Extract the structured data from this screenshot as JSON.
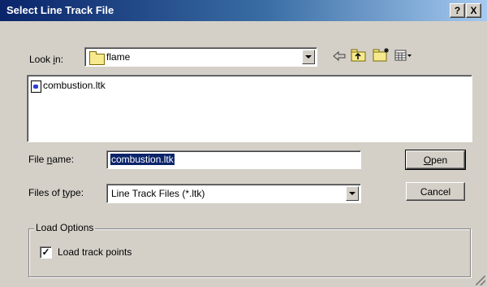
{
  "window": {
    "title": "Select Line Track File",
    "help_glyph": "?",
    "close_glyph": "X"
  },
  "look_in": {
    "label_prefix": "Look ",
    "label_mnemonic": "i",
    "label_suffix": "n:",
    "folder_name": "flame",
    "folder_icon": "folder-icon"
  },
  "toolbar": {
    "icons": [
      "back-arrow-icon",
      "up-folder-icon",
      "new-folder-icon",
      "view-menu-icon"
    ]
  },
  "file_list": {
    "items": [
      {
        "name": "combustion.ltk",
        "icon": "document-icon"
      }
    ]
  },
  "file_name": {
    "label_prefix": "File ",
    "label_mnemonic": "n",
    "label_suffix": "ame:",
    "value": "combustion.ltk"
  },
  "file_type": {
    "label_prefix": "Files of ",
    "label_mnemonic": "t",
    "label_suffix": "ype:",
    "selected": "Line Track Files (*.ltk)"
  },
  "buttons": {
    "open_mnemonic": "O",
    "open_rest": "pen",
    "cancel": "Cancel"
  },
  "load_options": {
    "title": "Load Options",
    "checkbox_label": "Load track points",
    "checkbox_mark": "✓",
    "checked": true
  },
  "colors": {
    "title_bar_start": "#0a246a",
    "title_bar_end": "#a6caf0",
    "face": "#d4d0c8",
    "selection": "#0a246a"
  }
}
